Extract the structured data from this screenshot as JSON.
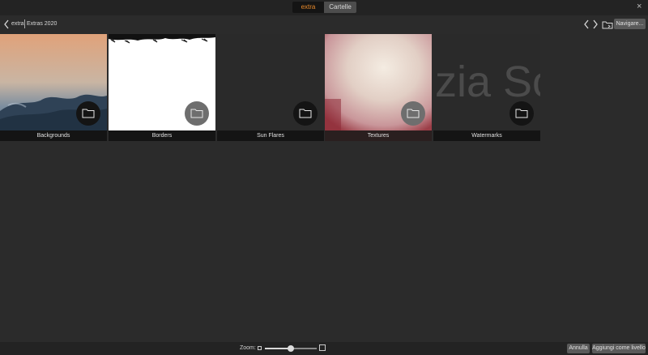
{
  "top_bar": {
    "segments": [
      {
        "label": "extra",
        "active": true
      },
      {
        "label": "Cartelle",
        "active": false
      }
    ],
    "close_glyph": "×"
  },
  "nav_bar": {
    "breadcrumb": [
      "extra",
      "Extras 2020"
    ],
    "navigate_label": "Navigare..."
  },
  "folders": [
    {
      "name": "Backgrounds",
      "thumb": "sunset-sky",
      "icon": "folder-icon"
    },
    {
      "name": "Borders",
      "thumb": "white-grunge-border",
      "icon": "folder-icon"
    },
    {
      "name": "Sun Flares",
      "thumb": "dark",
      "icon": "folder-icon"
    },
    {
      "name": "Textures",
      "thumb": "pink-paper-texture",
      "icon": "folder-icon"
    },
    {
      "name": "Watermarks",
      "thumb": "watermark-text",
      "watermark_text": "zia Sc",
      "icon": "folder-icon"
    }
  ],
  "bottom_bar": {
    "zoom_label": "Zoom:",
    "zoom_level": 0.5,
    "cancel_label": "Annulla",
    "add_label": "Aggiungi come livello"
  }
}
